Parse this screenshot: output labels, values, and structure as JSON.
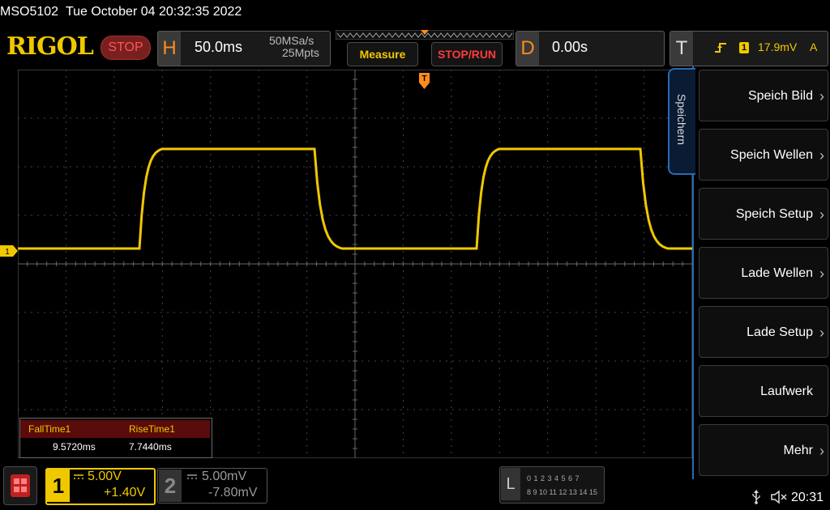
{
  "title_bar": {
    "model": "MSO5102",
    "datetime": "Tue October 04 20:32:35 2022"
  },
  "header": {
    "logo": "RIGOL",
    "run_state": "STOP",
    "horizontal": {
      "letter": "H",
      "timebase": "50.0ms",
      "sample_rate": "50MSa/s",
      "memory_depth": "25Mpts"
    },
    "measure_button": "Measure",
    "stop_run_button": "STOP/RUN",
    "delay": {
      "letter": "D",
      "value": "0.00s"
    },
    "trigger": {
      "letter": "T",
      "source": "1",
      "level": "17.9mV",
      "mode": "A",
      "edge_icon": "rising-edge-icon"
    }
  },
  "colors": {
    "ch1": "#f0c800",
    "accent_blue": "#2a6ab0",
    "stop_red": "#ff3b3b",
    "horizontal_orange": "#ff8c1a"
  },
  "waveform": {
    "channel": "1",
    "marker_label": "1",
    "periods_shown": "2",
    "high_level_div": 2.1,
    "low_level_div": 0.05
  },
  "measurements": {
    "items": [
      {
        "label": "FallTime1",
        "value": "9.5720ms"
      },
      {
        "label": "RiseTime1",
        "value": "7.7440ms"
      }
    ]
  },
  "menu": {
    "tab_label": "Speichern",
    "items": [
      {
        "label": "Speich Bild"
      },
      {
        "label": "Speich Wellen"
      },
      {
        "label": "Speich Setup"
      },
      {
        "label": "Lade Wellen"
      },
      {
        "label": "Lade Setup"
      },
      {
        "label": "Laufwerk"
      },
      {
        "label": "Mehr"
      }
    ]
  },
  "channels": {
    "ch1": {
      "number": "1",
      "scale": "5.00V",
      "offset": "+1.40V",
      "coupling": "DC"
    },
    "ch2": {
      "number": "2",
      "scale": "5.00mV",
      "offset": "-7.80mV",
      "coupling": "DC"
    }
  },
  "logic": {
    "letter": "L",
    "row1": "0 1 2 3  4 5 6 7",
    "row2": "8 9 10 11 12 13 14 15"
  },
  "status": {
    "time": "20:31"
  }
}
